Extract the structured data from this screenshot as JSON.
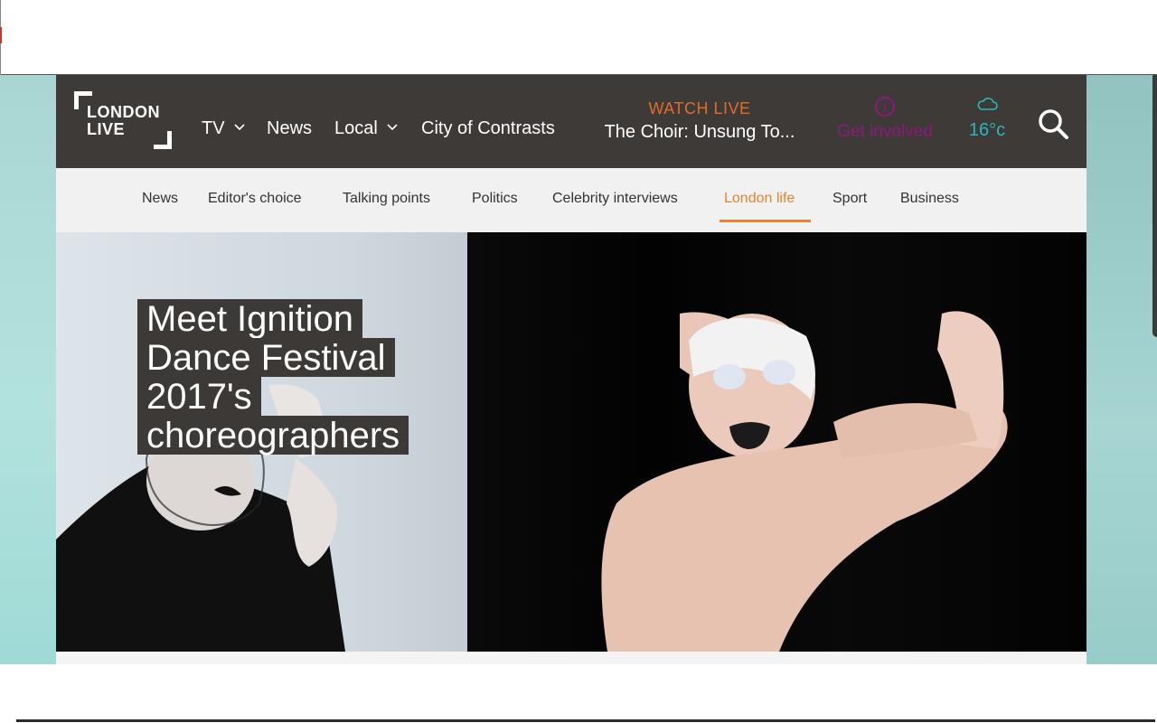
{
  "header": {
    "logo_line1": "LONDON",
    "logo_line2": "LIVE",
    "nav": [
      {
        "label": "TV",
        "has_dropdown": true
      },
      {
        "label": "News",
        "has_dropdown": false
      },
      {
        "label": "Local",
        "has_dropdown": true
      },
      {
        "label": "City of Contrasts",
        "has_dropdown": false
      }
    ],
    "watch_live_label": "WATCH LIVE",
    "now_playing": "The Choir: Unsung To...",
    "get_involved_label": "Get involved",
    "temperature": "16°c",
    "icons": {
      "weather": "cloud-icon",
      "search": "search-icon",
      "get_involved": "info-circle-icon",
      "dropdown": "chevron-down-icon"
    }
  },
  "subnav": {
    "items": [
      "News",
      "Editor's choice",
      "Talking points",
      "Politics",
      "Celebrity interviews",
      "London life",
      "Sport",
      "Business"
    ],
    "active": "London life"
  },
  "hero": {
    "title_lines": [
      "Meet Ignition",
      "Dance Festival",
      "2017's",
      "choreographers"
    ]
  },
  "colors": {
    "header_bg": "#3e3a38",
    "accent_orange": "#e5862f",
    "watch_live": "#e06c2c",
    "get_involved": "#8b1a7a",
    "weather": "#2bb7bb"
  }
}
